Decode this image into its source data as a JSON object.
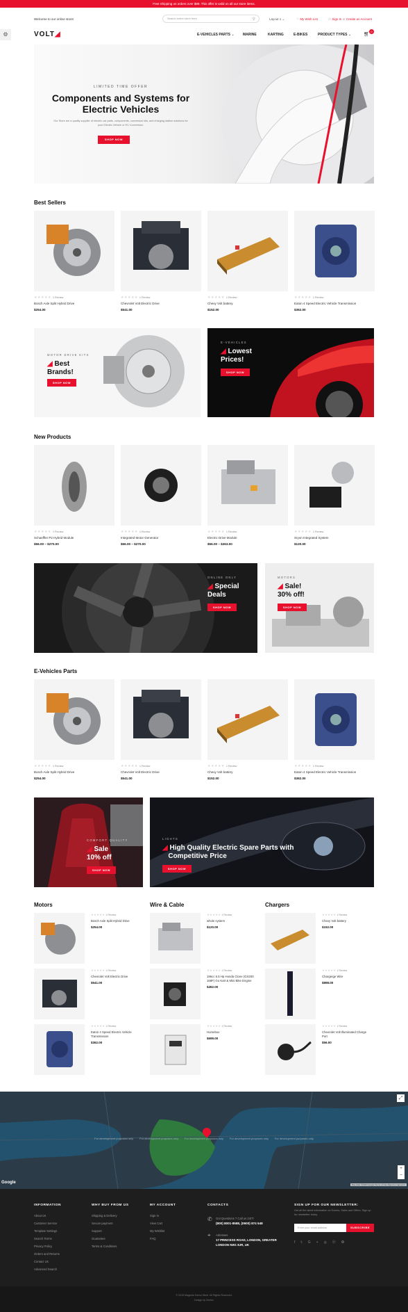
{
  "topbar": {
    "text": "Free Shipping on orders over $99. This offer is valid on all our store items."
  },
  "header": {
    "welcome": "Welcome to our online store!",
    "search_placeholder": "Search entire store here",
    "currency": "Layout 1",
    "wishlist": "My Wish List",
    "signin": "Sign In",
    "or": "or",
    "create_account": "Create an Account",
    "logo_main": "VOLT",
    "cart_count": "0"
  },
  "nav": [
    {
      "label": "E-VEHICLES PARTS"
    },
    {
      "label": "MARINE"
    },
    {
      "label": "KARTING"
    },
    {
      "label": "E-BIKES"
    },
    {
      "label": "PRODUCT TYPES"
    }
  ],
  "hero": {
    "tag": "LIMITED TIME OFFER",
    "title": "Components and Systems for Electric Vehicles",
    "sub": "Our Store are a quality supplier of electric car parts, components, conversion kits, and charging station solutions for your Electric Vehicle or EV Conversion.",
    "button": "SHOP NOW"
  },
  "best_sellers": {
    "title": "Best Sellers",
    "items": [
      {
        "name": "Bosch Axle Split Hybrid Drive",
        "reviews": "1 Review",
        "price": "$254.00"
      },
      {
        "name": "Chevrolet Volt Electric Drive",
        "reviews": "1 Review",
        "price": "$541.00"
      },
      {
        "name": "Chevy Volt battery",
        "reviews": "1 Review",
        "price": "$152.00"
      },
      {
        "name": "Eaton 4 Speed Electric Vehicle Transmission",
        "reviews": "1 Review",
        "price": "$362.00"
      }
    ]
  },
  "promo1": {
    "a": {
      "tag": "MOTOR DRIVE KITS",
      "title1": "Best",
      "title2": "Brands!",
      "button": "SHOP NOW"
    },
    "b": {
      "tag": "E-VEHICLES",
      "title1": "Lowest",
      "title2": "Prices!",
      "button": "SHOP NOW"
    }
  },
  "new_products": {
    "title": "New Products",
    "items": [
      {
        "name": "Schaeffler P2 Hybrid Module",
        "reviews": "1 Review",
        "price": "$56.00 – $270.00"
      },
      {
        "name": "Integrated Motor Generator",
        "reviews": "1 Review",
        "price": "$56.00 – $270.00"
      },
      {
        "name": "Electric Drive Module",
        "reviews": "1 Review",
        "price": "$56.00 – $263.00"
      },
      {
        "name": "Sryon Integrated System",
        "reviews": "1 Review",
        "price": "$120.00"
      }
    ]
  },
  "promo2": {
    "a": {
      "tag": "ONLINE ONLY",
      "title1": "Special",
      "title2": "Deals",
      "button": "SHOP NOW"
    },
    "b": {
      "tag": "MOTORS",
      "title1": "Sale!",
      "title2": "30% off!",
      "button": "SHOP NOW"
    }
  },
  "evp": {
    "title": "E-Vehicles Parts",
    "items": [
      {
        "name": "Bosch Axle Split Hybrid Drive",
        "reviews": "1 Review",
        "price": "$254.00"
      },
      {
        "name": "Chevrolet Volt Electric Drive",
        "reviews": "1 Review",
        "price": "$541.00"
      },
      {
        "name": "Chevy Volt battery",
        "reviews": "1 Review",
        "price": "$152.00"
      },
      {
        "name": "Eaton 4 Speed Electric Vehicle Transmission",
        "reviews": "1 Review",
        "price": "$362.00"
      }
    ]
  },
  "promo3": {
    "a": {
      "tag": "COMFORT QUALITY",
      "title1": "Sale",
      "title2": "10% off",
      "button": "SHOP NOW"
    },
    "b": {
      "tag": "LIGHTS",
      "title1": "High Quality Electric Spare Parts with",
      "title2": "Competitive Price",
      "button": "SHOP NOW"
    }
  },
  "lists": [
    {
      "title": "Motors",
      "items": [
        {
          "name": "Bosch Axle Split Hybrid Drive",
          "reviews": "1 Review",
          "price": "$254.00"
        },
        {
          "name": "Chevrolet Volt Electric Drive",
          "reviews": "1 Review",
          "price": "$541.00"
        },
        {
          "name": "Eaton 4 Speed Electric Vehicle Transmission",
          "reviews": "1 Review",
          "price": "$362.00"
        }
      ]
    },
    {
      "title": "Wire & Cable",
      "items": [
        {
          "name": "whole system",
          "reviews": "1 Review",
          "price": "$120.00"
        },
        {
          "name": "196cc 6.5 Hp Honda Clone (GX200 168F) Go Kart & Mini Bike Engine",
          "reviews": "1 Review",
          "price": "$452.00"
        },
        {
          "name": "Homebox",
          "reviews": "1 Review",
          "price": "$699.00"
        }
      ]
    },
    {
      "title": "Chargers",
      "items": [
        {
          "name": "Chevy Volt battery",
          "reviews": "1 Review",
          "price": "$152.00"
        },
        {
          "name": "Chargerge Wire",
          "reviews": "1 Review",
          "price": "$898.00"
        },
        {
          "name": "Chevrolet Volt Illuminated Charge Port",
          "reviews": "1 Review",
          "price": "$56.00"
        }
      ]
    }
  ],
  "map": {
    "watermark": "For development purposes only",
    "google": "Google",
    "terms": "Map data ©2019 Google  Terms of Use  Report a map error"
  },
  "footer": {
    "info": {
      "title": "INFORMATION",
      "links": [
        "About Us",
        "Customer Service",
        "Template Settings",
        "Search Terms",
        "Privacy Policy",
        "Orders and Returns",
        "Contact Us",
        "Advanced Search"
      ]
    },
    "why": {
      "title": "WHY BUY FROM US",
      "links": [
        "Shipping & Delivery",
        "Secure payment",
        "Support",
        "Guarantee",
        "Terms & Conditions"
      ]
    },
    "account": {
      "title": "MY ACCOUNT",
      "links": [
        "Sign In",
        "View Cart",
        "My Wishlist",
        "FAQ"
      ]
    },
    "contacts": {
      "title": "CONTACTS",
      "q": "Got Questions ? Call us 24/7!",
      "phone": "(800) 8001-8588, (0600) 874 548",
      "addr_label": "Adresses",
      "addr": "17 PRINCESS ROAD, LONDON, GREATER LONDON NW1 8JR, UK"
    },
    "newsletter": {
      "title": "SIGN UP FOR OUR NEWSLETTER:",
      "sub": "Get all the latest information on Events, Sales and Offers. Sign up for newsletter today.",
      "placeholder": "Enter your email address",
      "button": "SUBSCRIBE"
    },
    "copyright": "© 2019 Magento Demo Store. All Rights Reserved.",
    "design": "Design by Zemez"
  }
}
